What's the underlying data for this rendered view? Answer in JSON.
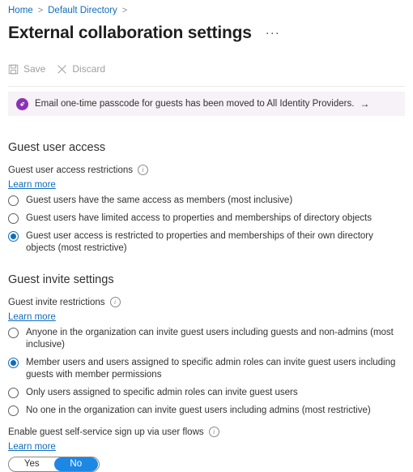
{
  "breadcrumb": {
    "items": [
      "Home",
      "Default Directory"
    ],
    "separator": ">"
  },
  "header": {
    "title": "External collaboration settings",
    "more_menu": "···"
  },
  "toolbar": {
    "save_label": "Save",
    "discard_label": "Discard",
    "save_icon": "save-floppy-icon",
    "discard_icon": "close-x-icon"
  },
  "banner": {
    "icon": "announcement-icon",
    "text": "Email one-time passcode for guests has been moved to All Identity Providers.",
    "arrow": "→",
    "background": "#f7f1f8",
    "icon_color": "#8c31b4"
  },
  "guest_user_access": {
    "heading": "Guest user access",
    "field_label": "Guest user access restrictions",
    "info_icon": "info-circle-icon",
    "learn_more": "Learn more",
    "selected_index": 2,
    "options": [
      "Guest users have the same access as members (most inclusive)",
      "Guest users have limited access to properties and memberships of directory objects",
      "Guest user access is restricted to properties and memberships of their own directory objects (most restrictive)"
    ]
  },
  "guest_invite_settings": {
    "heading": "Guest invite settings",
    "field_label": "Guest invite restrictions",
    "info_icon": "info-circle-icon",
    "learn_more": "Learn more",
    "selected_index": 1,
    "options": [
      "Anyone in the organization can invite guest users including guests and non-admins (most inclusive)",
      "Member users and users assigned to specific admin roles can invite guest users including guests with member permissions",
      "Only users assigned to specific admin roles can invite guest users",
      "No one in the organization can invite guest users including admins (most restrictive)"
    ]
  },
  "self_service": {
    "field_label": "Enable guest self-service sign up via user flows",
    "info_icon": "info-circle-icon",
    "learn_more": "Learn more",
    "toggle": {
      "yes_label": "Yes",
      "no_label": "No",
      "value": "No",
      "active_color": "#1d87e4"
    }
  },
  "colors": {
    "link": "#0f6cbd",
    "accent": "#0f6cbd",
    "text": "#323130",
    "disabled": "#a19f9d"
  }
}
